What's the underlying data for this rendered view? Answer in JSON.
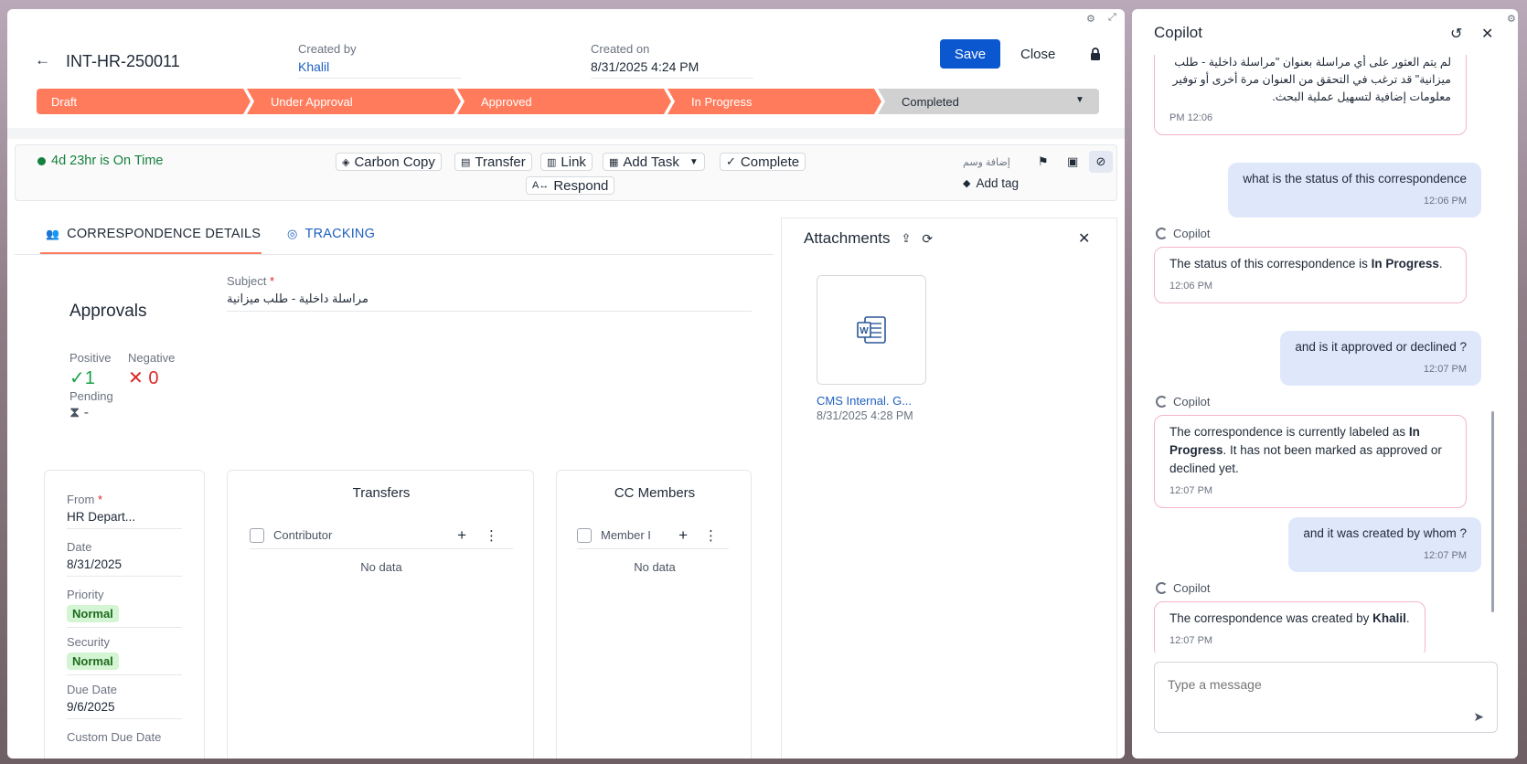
{
  "header": {
    "doc_id": "INT-HR-250011",
    "created_by_label": "Created by",
    "created_by": "Khalil",
    "created_on_label": "Created on",
    "created_on": "8/31/2025 4:24 PM",
    "save_label": "Save",
    "close_label": "Close"
  },
  "stepper": {
    "steps": [
      "Draft",
      "Under Approval",
      "Approved",
      "In Progress",
      "Completed"
    ]
  },
  "actions": {
    "sla": "4d 23hr is On Time",
    "carbon_copy": "Carbon Copy",
    "transfer": "Transfer",
    "link": "Link",
    "add_task": "Add Task",
    "complete": "Complete",
    "respond": "Respond",
    "tag_arabic": "إضافة وسم",
    "add_tag": "Add tag"
  },
  "tabs": {
    "details": "CORRESPONDENCE DETAILS",
    "tracking": "TRACKING"
  },
  "details": {
    "subject_label": "Subject",
    "subject": "مراسلة داخلية - طلب ميزانية",
    "approvals_title": "Approvals",
    "positive_label": "Positive",
    "positive": "1",
    "negative_label": "Negative",
    "negative": "0",
    "pending_label": "Pending",
    "pending": "-",
    "from_label": "From",
    "from": "HR Depart...",
    "date_label": "Date",
    "date": "8/31/2025",
    "priority_label": "Priority",
    "priority": "Normal",
    "security_label": "Security",
    "security": "Normal",
    "due_date_label": "Due Date",
    "due_date": "9/6/2025",
    "custom_due_label": "Custom Due Date",
    "transfers_title": "Transfers",
    "transfers_col": "Contributor",
    "transfers_empty": "No data",
    "cc_title": "CC Members",
    "cc_col": "Member I",
    "cc_empty": "No data"
  },
  "attachments": {
    "title": "Attachments",
    "file_name": "CMS Internal. G...",
    "file_date": "8/31/2025 4:28 PM"
  },
  "copilot": {
    "title": "Copilot",
    "sender": "Copilot",
    "m0_text": "لم يتم العثور على أي مراسلة بعنوان \"مراسلة داخلية - طلب ميزانية\" قد ترغب في التحقق من العنوان مرة أخرى أو توفير معلومات إضافية لتسهيل عملية البحث.",
    "m0_time": "12:06 PM",
    "m1_text": "what is the status of this correspondence",
    "m1_time": "12:06 PM",
    "m2_a": "The status of this correspondence is ",
    "m2_b": "In Progress",
    "m2_c": ".",
    "m2_time": "12:06 PM",
    "m3_text": "and is it approved or declined ?",
    "m3_time": "12:07 PM",
    "m4_a": "The correspondence is currently labeled as ",
    "m4_b": "In Progress",
    "m4_c": ". It has not been marked as approved or declined yet.",
    "m4_time": "12:07 PM",
    "m5_text": "and it was created by whom ?",
    "m5_time": "12:07 PM",
    "m6_a": "The correspondence was created by ",
    "m6_b": "Khalil",
    "m6_c": ".",
    "m6_time": "12:07 PM",
    "input_placeholder": "Type a message"
  },
  "colors": {
    "accent": "#0b57d0",
    "step_done": "#ff7b5c",
    "step_pending": "#d1d1d1",
    "success": "#16a34a",
    "danger": "#dc2626"
  }
}
